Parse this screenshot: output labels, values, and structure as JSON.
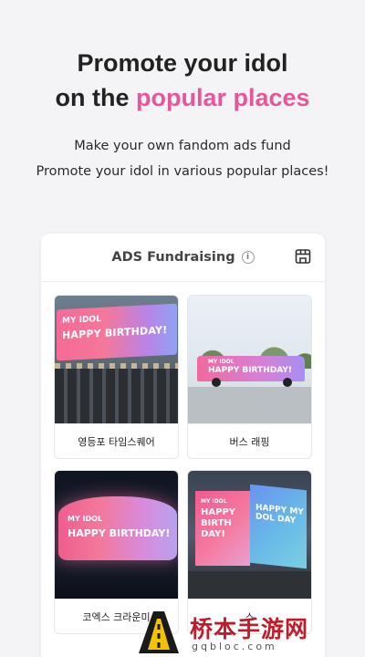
{
  "hero": {
    "title_line1": "Promote your idol",
    "title_line2_prefix": "on the ",
    "title_line2_accent": "popular places",
    "subtitle_line1": "Make your own fandom ads fund",
    "subtitle_line2": "Promote your idol in various popular places!"
  },
  "card": {
    "title": "ADS Fundraising",
    "info_icon": "i",
    "store_icon": "store-icon"
  },
  "places": [
    {
      "label": "영등포 타임스퀘어",
      "banner_small": "MY IDOL",
      "banner_big": "HAPPY BIRTHDAY!"
    },
    {
      "label": "버스 래핑",
      "banner_small": "MY IDOL",
      "banner_big": "HAPPY BIRTHDAY!"
    },
    {
      "label": "코엑스 크라운미",
      "banner_small": "MY IDOL",
      "banner_big": "HAPPY BIRTHDAY!"
    },
    {
      "label": "스",
      "banner_small": "MY IDOL",
      "banner_big": "HAPPY BIRTH DAY!",
      "banner_right": "HAPPY MY DOL DAY"
    }
  ],
  "watermark": {
    "text": "桥本手游网",
    "url": "gqbloc.com"
  },
  "colors": {
    "accent": "#e8559b",
    "background": "#f4f4f6"
  }
}
